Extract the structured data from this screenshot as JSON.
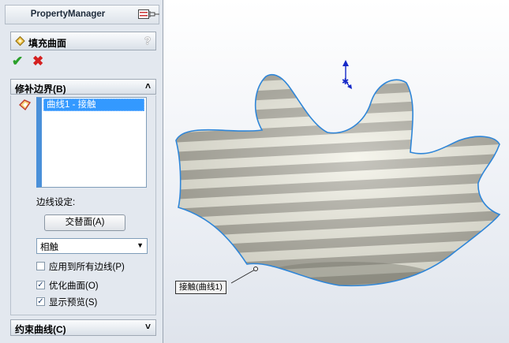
{
  "panel": {
    "title": "PropertyManager",
    "feature_title": "填充曲面",
    "help": "?",
    "ok": "✔",
    "cancel": "✖",
    "patch_group": {
      "title": "修补边界(B)",
      "list_items": [
        "曲线1 - 接触"
      ],
      "edge_settings_label": "边线设定:",
      "alternate_button": "交替面(A)",
      "contact_type": "相触",
      "apply_all_label": "应用到所有边线(P)",
      "apply_all_checked": false,
      "optimize_label": "优化曲面(O)",
      "optimize_checked": true,
      "preview_label": "显示预览(S)",
      "preview_checked": true
    },
    "constraint_group": {
      "title": "约束曲线(C)"
    }
  },
  "viewport": {
    "callout_label": "接触(曲线1)",
    "colors": {
      "stripe_light": "#f2f1e4",
      "stripe_dark": "#a9a79c",
      "edge": "#2f86d8",
      "triad": "#1528c8"
    }
  }
}
